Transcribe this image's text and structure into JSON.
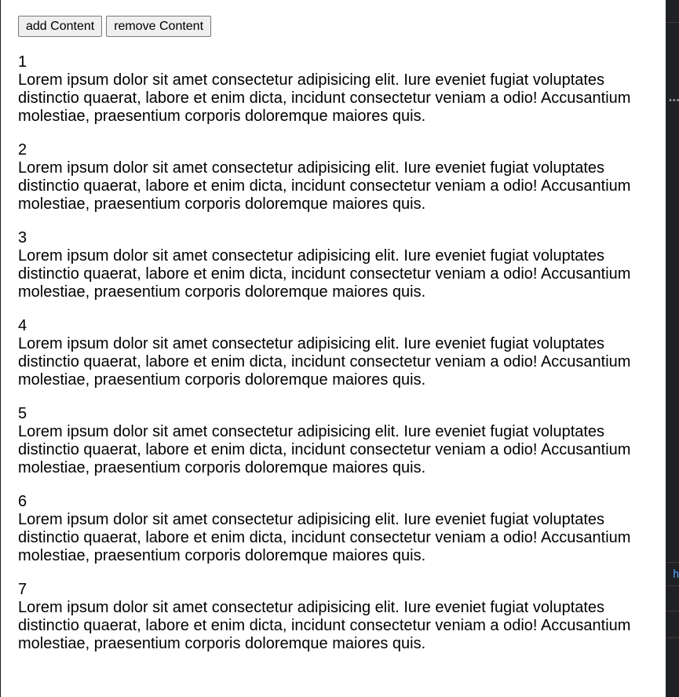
{
  "toolbar": {
    "add_label": "add Content",
    "remove_label": "remove Content"
  },
  "items": [
    {
      "number": "1",
      "text": "Lorem ipsum dolor sit amet consectetur adipisicing elit. Iure eveniet fugiat voluptates distinctio quaerat, labore et enim dicta, incidunt consectetur veniam a odio! Accusantium molestiae, praesentium corporis doloremque maiores quis."
    },
    {
      "number": "2",
      "text": "Lorem ipsum dolor sit amet consectetur adipisicing elit. Iure eveniet fugiat voluptates distinctio quaerat, labore et enim dicta, incidunt consectetur veniam a odio! Accusantium molestiae, praesentium corporis doloremque maiores quis."
    },
    {
      "number": "3",
      "text": "Lorem ipsum dolor sit amet consectetur adipisicing elit. Iure eveniet fugiat voluptates distinctio quaerat, labore et enim dicta, incidunt consectetur veniam a odio! Accusantium molestiae, praesentium corporis doloremque maiores quis."
    },
    {
      "number": "4",
      "text": "Lorem ipsum dolor sit amet consectetur adipisicing elit. Iure eveniet fugiat voluptates distinctio quaerat, labore et enim dicta, incidunt consectetur veniam a odio! Accusantium molestiae, praesentium corporis doloremque maiores quis."
    },
    {
      "number": "5",
      "text": "Lorem ipsum dolor sit amet consectetur adipisicing elit. Iure eveniet fugiat voluptates distinctio quaerat, labore et enim dicta, incidunt consectetur veniam a odio! Accusantium molestiae, praesentium corporis doloremque maiores quis."
    },
    {
      "number": "6",
      "text": "Lorem ipsum dolor sit amet consectetur adipisicing elit. Iure eveniet fugiat voluptates distinctio quaerat, labore et enim dicta, incidunt consectetur veniam a odio! Accusantium molestiae, praesentium corporis doloremque maiores quis."
    },
    {
      "number": "7",
      "text": "Lorem ipsum dolor sit amet consectetur adipisicing elit. Iure eveniet fugiat voluptates distinctio quaerat, labore et enim dicta, incidunt consectetur veniam a odio! Accusantium molestiae, praesentium corporis doloremque maiores quis."
    }
  ],
  "devtools_strip": {
    "handle_icon": "drag-handle-icon",
    "glyph": "h"
  }
}
